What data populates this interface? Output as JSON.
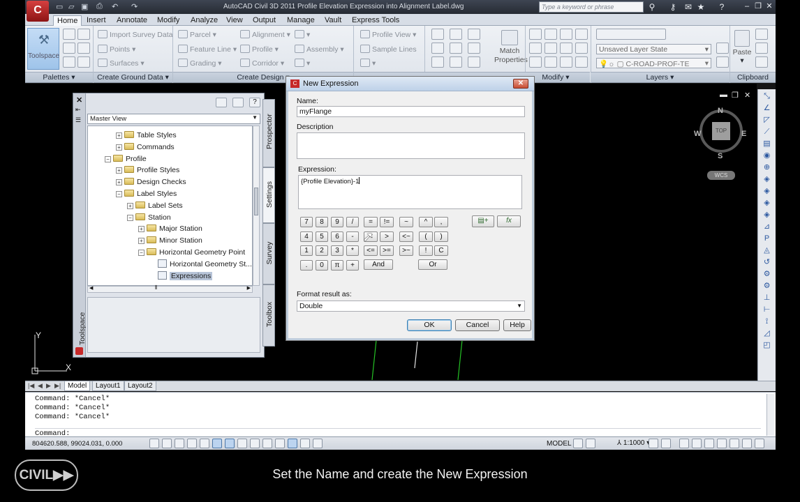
{
  "window": {
    "title": "AutoCAD Civil 3D 2011    Profile Elevation Expression into Alignment Label.dwg",
    "search_placeholder": "Type a keyword or phrase"
  },
  "ribbon_tabs": [
    "Home",
    "Insert",
    "Annotate",
    "Modify",
    "Analyze",
    "View",
    "Output",
    "Manage",
    "Vault",
    "Express Tools"
  ],
  "ribbon": {
    "toolspace_label": "Toolspace",
    "ground_data": [
      "Import Survey Data",
      "Points",
      "Surfaces"
    ],
    "parcels": [
      "Parcel",
      "Feature Line",
      "Grading"
    ],
    "design": [
      "Alignment",
      "Profile",
      "Corridor"
    ],
    "assembly": "Assembly",
    "profile_view": [
      "Profile View",
      "Sample Lines"
    ],
    "match_properties": "Match Properties",
    "layer_state": "Unsaved Layer State",
    "current_layer": "C-ROAD-PROF-TE",
    "paste": "Paste",
    "panels": [
      "Palettes",
      "Create Ground Data",
      "Create Design",
      "Modify",
      "Layers",
      "Clipboard"
    ]
  },
  "toolspace": {
    "view_select": "Master View",
    "vertical_title": "Toolspace",
    "tabs": [
      "Prospector",
      "Settings",
      "Survey",
      "Toolbox"
    ],
    "tree": [
      {
        "label": "Table Styles",
        "pm": "+",
        "icon": "folder"
      },
      {
        "label": "Commands",
        "pm": "+",
        "icon": "folder"
      },
      {
        "label": "Profile",
        "pm": "−",
        "icon": "profile"
      },
      {
        "label": "Profile Styles",
        "pm": "+",
        "icon": "folder"
      },
      {
        "label": "Design Checks",
        "pm": "+",
        "icon": "folder"
      },
      {
        "label": "Label Styles",
        "pm": "−",
        "icon": "folder"
      },
      {
        "label": "Label Sets",
        "pm": "+",
        "icon": "folder"
      },
      {
        "label": "Station",
        "pm": "−",
        "icon": "folder"
      },
      {
        "label": "Major Station",
        "pm": "+",
        "icon": "folder"
      },
      {
        "label": "Minor Station",
        "pm": "+",
        "icon": "folder"
      },
      {
        "label": "Horizontal Geometry Point",
        "pm": "−",
        "icon": "folder"
      },
      {
        "label": "Horizontal Geometry St...",
        "pm": "",
        "icon": "leaf"
      },
      {
        "label": "Expressions",
        "pm": "",
        "icon": "leaf"
      }
    ]
  },
  "dialog": {
    "title": "New Expression",
    "name_label": "Name:",
    "name_value": "myFlange",
    "description_label": "Description",
    "description_value": "",
    "expression_label": "Expression:",
    "expression_value": "{Profile Elevation}-1",
    "keypad": [
      [
        "7",
        "8",
        "9",
        "/"
      ],
      [
        "4",
        "5",
        "6",
        "-"
      ],
      [
        "1",
        "2",
        "3",
        "*"
      ],
      [
        ".",
        "0",
        "π",
        "+"
      ]
    ],
    "operators": [
      [
        "=",
        "!=",
        "~",
        "^",
        ","
      ],
      [
        "<",
        ">",
        "<~",
        "(",
        ")"
      ],
      [
        "<=",
        ">=",
        ">~",
        "!",
        "C"
      ]
    ],
    "and_label": "And",
    "or_label": "Or",
    "format_label": "Format result as:",
    "format_value": "Double",
    "ok_label": "OK",
    "cancel_label": "Cancel",
    "help_label": "Help"
  },
  "viewcube": {
    "top": "TOP",
    "n": "N",
    "s": "S",
    "e": "E",
    "w": "W",
    "wcs": "WCS"
  },
  "layout_tabs": [
    "Model",
    "Layout1",
    "Layout2"
  ],
  "command_history": [
    "Command: *Cancel*",
    "Command: *Cancel*",
    "Command: *Cancel*"
  ],
  "command_prompt": "Command:",
  "status": {
    "coordinates": "804620.588, 99024.031, 0.000",
    "model": "MODEL",
    "scale": "1:1000"
  },
  "caption": "Set the Name and create the New Expression",
  "brand_logo": "CIVIL▶▶"
}
